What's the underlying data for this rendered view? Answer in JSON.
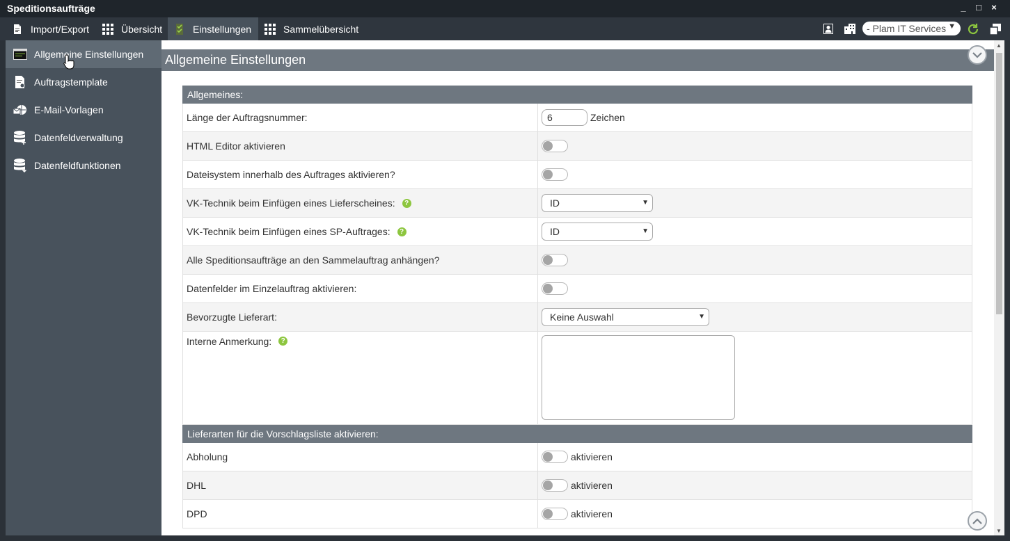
{
  "window": {
    "title": "Speditionsaufträge",
    "minimize": "_",
    "maximize": "□",
    "close": "×"
  },
  "toolbar": {
    "tabs": [
      {
        "label": "Import/Export",
        "icon": "document-icon"
      },
      {
        "label": "Übersicht",
        "icon": "grid-icon"
      },
      {
        "label": "Einstellungen",
        "icon": "checklist-icon",
        "active": true
      },
      {
        "label": "Sammelübersicht",
        "icon": "grid-icon"
      }
    ],
    "company_select": "- Plam IT Services"
  },
  "sidebar": {
    "items": [
      {
        "label": "Allgemeine Einstellungen",
        "icon": "window-icon",
        "active": true
      },
      {
        "label": "Auftragstemplate",
        "icon": "document-gear-icon"
      },
      {
        "label": "E-Mail-Vorlagen",
        "icon": "email-globe-icon"
      },
      {
        "label": "Datenfeldverwaltung",
        "icon": "database-icon"
      },
      {
        "label": "Datenfeldfunktionen",
        "icon": "database-download-icon"
      }
    ]
  },
  "main": {
    "title": "Allgemeine Einstellungen",
    "sections": {
      "general": "Allgemeines:",
      "delivery": "Lieferarten für die Vorschlagsliste aktivieren:"
    },
    "rows": {
      "order_number_length": {
        "label": "Länge der Auftragsnummer:",
        "value": "6",
        "unit": "Zeichen"
      },
      "html_editor": {
        "label": "HTML Editor aktivieren"
      },
      "filesystem": {
        "label": "Dateisystem innerhalb des Auftrages aktivieren?"
      },
      "vk_delivery_note": {
        "label": "VK-Technik beim Einfügen eines Lieferscheines:",
        "value": "ID"
      },
      "vk_sp_order": {
        "label": "VK-Technik beim Einfügen eines SP-Auftrages:",
        "value": "ID"
      },
      "attach_collective": {
        "label": "Alle Speditionsaufträge an den Sammelauftrag anhängen?"
      },
      "datafields_single": {
        "label": "Datenfelder im Einzelauftrag aktivieren:"
      },
      "preferred_delivery": {
        "label": "Bevorzugte Lieferart:",
        "value": "Keine Auswahl"
      },
      "internal_note": {
        "label": "Interne Anmerkung:",
        "value": ""
      }
    },
    "delivery_types": [
      {
        "label": "Abholung",
        "toggle_label": "aktivieren"
      },
      {
        "label": "DHL",
        "toggle_label": "aktivieren"
      },
      {
        "label": "DPD",
        "toggle_label": "aktivieren"
      }
    ],
    "help_glyph": "?"
  },
  "colors": {
    "toolbar_bg": "#2f363e",
    "sidebar_bg": "#48525c",
    "section_bg": "#6e7780",
    "help_green": "#8dc63f",
    "refresh_green": "#8dc63f"
  }
}
